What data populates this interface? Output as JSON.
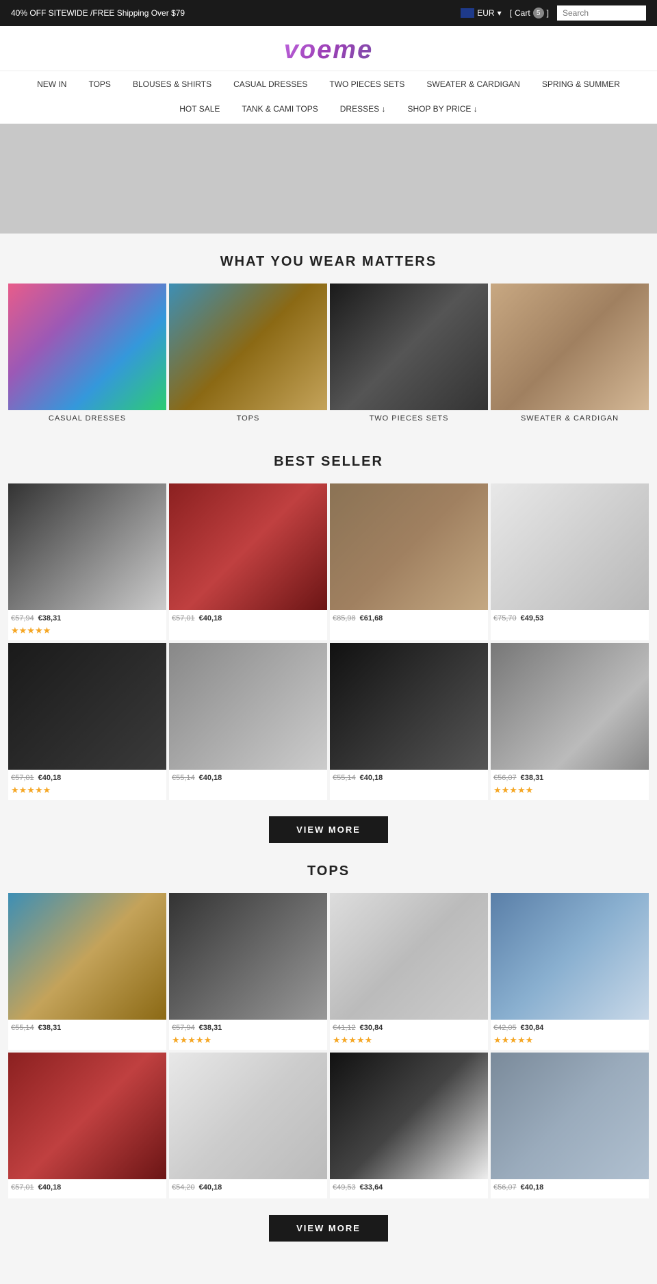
{
  "topbar": {
    "promo": "40% OFF SITEWIDE /FREE Shipping Over $79",
    "currency": "EUR",
    "cart_label": "Cart",
    "cart_count": "5",
    "search_placeholder": "Search"
  },
  "logo": "voeme",
  "nav": {
    "row1": [
      {
        "label": "NEW IN"
      },
      {
        "label": "TOPS"
      },
      {
        "label": "BLOUSES & SHIRTS"
      },
      {
        "label": "CASUAL DRESSES"
      },
      {
        "label": "TWO PIECES SETS"
      },
      {
        "label": "SWEATER & CARDIGAN"
      },
      {
        "label": "SPRING & SUMMER"
      }
    ],
    "row2": [
      {
        "label": "HOT SALE"
      },
      {
        "label": "TANK & CAMI TOPS"
      },
      {
        "label": "DRESSES ↓"
      },
      {
        "label": "SHOP BY PRICE ↓"
      }
    ]
  },
  "what_you_wear": {
    "title": "WHAT YOU WEAR MATTERS",
    "categories": [
      {
        "label": "CASUAL DRESSES"
      },
      {
        "label": "TOPS"
      },
      {
        "label": "TWO PIECES SETS"
      },
      {
        "label": "SWEATER & CARDIGAN"
      }
    ]
  },
  "best_seller": {
    "title": "BEST SELLER",
    "products": [
      {
        "old_price": "€57,94",
        "new_price": "€38,31",
        "stars": "★★★★★"
      },
      {
        "old_price": "€57,01",
        "new_price": "€40,18",
        "stars": ""
      },
      {
        "old_price": "€85,98",
        "new_price": "€61,68",
        "stars": ""
      },
      {
        "old_price": "€75,70",
        "new_price": "€49,53",
        "stars": ""
      },
      {
        "old_price": "€57,01",
        "new_price": "€40,18",
        "stars": "★★★★★"
      },
      {
        "old_price": "€55,14",
        "new_price": "€40,18",
        "stars": ""
      },
      {
        "old_price": "€55,14",
        "new_price": "€40,18",
        "stars": ""
      },
      {
        "old_price": "€56,07",
        "new_price": "€38,31",
        "stars": "★★★★★"
      }
    ],
    "view_more": "VIEW MORE"
  },
  "tops": {
    "title": "TOPS",
    "products": [
      {
        "old_price": "€55,14",
        "new_price": "€38,31",
        "stars": ""
      },
      {
        "old_price": "€57,94",
        "new_price": "€38,31",
        "stars": "★★★★★"
      },
      {
        "old_price": "€41,12",
        "new_price": "€30,84",
        "stars": "★★★★★"
      },
      {
        "old_price": "€42,05",
        "new_price": "€30,84",
        "stars": "★★★★★"
      },
      {
        "old_price": "€57,01",
        "new_price": "€40,18",
        "stars": ""
      },
      {
        "old_price": "€54,20",
        "new_price": "€40,18",
        "stars": ""
      },
      {
        "old_price": "€49,53",
        "new_price": "€33,64",
        "stars": ""
      },
      {
        "old_price": "€56,07",
        "new_price": "€40,18",
        "stars": ""
      }
    ],
    "view_more": "VIEW MORE"
  }
}
